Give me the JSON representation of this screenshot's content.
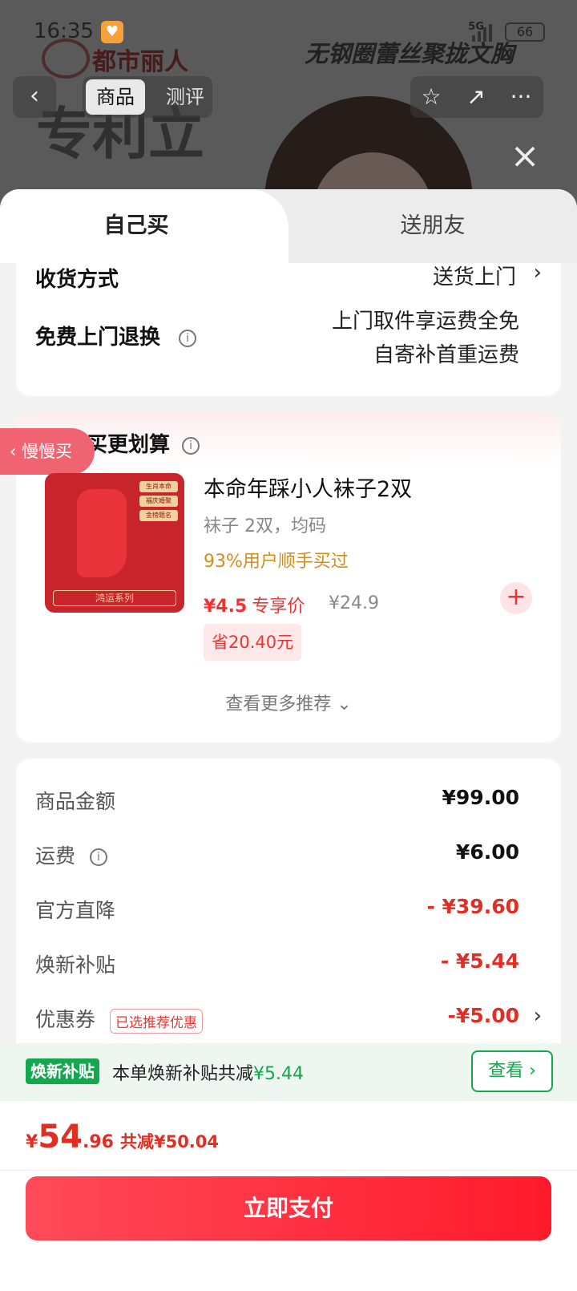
{
  "status_bar": {
    "time": "16:35",
    "network": "5G",
    "battery": "66"
  },
  "background": {
    "brand": "都市丽人",
    "slogan": "无钢圈蕾丝聚拢文胸",
    "promo_text": "专利立",
    "tabs": {
      "active": "商品",
      "inactive": "测评"
    }
  },
  "sheet": {
    "tabs": {
      "self": "自己买",
      "gift": "送朋友"
    },
    "delivery": {
      "method_label": "收货方式",
      "method_value": "送货上门",
      "return_label": "免费上门退换",
      "return_line1": "上门取件享运费全免",
      "return_line2": "自寄补首重运费"
    },
    "bundle": {
      "title": "顺手买更划算",
      "slow_buy": "慢慢买",
      "product": {
        "name": "本命年踩小人袜子2双",
        "spec": "袜子 2双，均码",
        "social": "93%用户顺手买过",
        "price": "¥4.5",
        "price_tag": "专享价",
        "original_price": "¥24.9",
        "save": "省20.40元",
        "image_badges": [
          "生肖本命",
          "福庆婚聚",
          "金榜题名"
        ],
        "image_series": "鸿运系列"
      },
      "more": "查看更多推荐"
    },
    "summary": {
      "rows": [
        {
          "label": "商品金额",
          "value": "¥99.00"
        },
        {
          "label": "运费",
          "value": "¥6.00"
        },
        {
          "label": "官方直降",
          "value": "- ¥39.60"
        },
        {
          "label": "焕新补贴",
          "value": "- ¥5.44"
        },
        {
          "label": "优惠券",
          "value": "-¥5.00",
          "tag": "已选推荐优惠"
        }
      ]
    },
    "subsidy": {
      "tag": "焕新补贴",
      "text": "本单焕新补贴共减",
      "amount": "¥5.44",
      "view": "查看"
    },
    "pay": {
      "currency": "¥",
      "amount_int": "54",
      "amount_dec": ".96",
      "reduced": "共减¥50.04",
      "button": "立即支付"
    }
  },
  "colors": {
    "accent_red": "#e02e24",
    "green": "#15a74f",
    "pay_gradient_start": "#ff4a5a",
    "pay_gradient_end": "#ff1a2a"
  }
}
